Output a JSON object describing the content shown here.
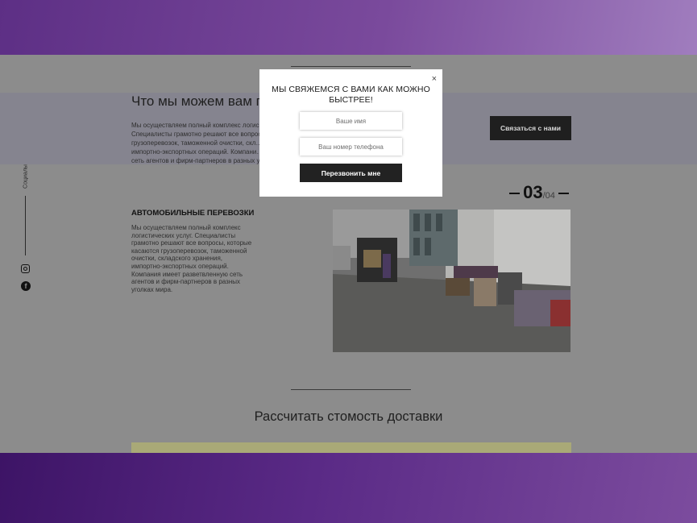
{
  "services": {
    "title": "Что мы можем вам п",
    "text": "Мы осуществляем полный комплекс логис… Специалисты грамотно решают все вопросы грузоперевозок, таможенной очистки, скл… импортно-экспортных операций. Компани… сеть агентов и фирм-партнеров в разных у…",
    "contact_button": "Связаться с нами"
  },
  "sidebar": {
    "label": "Социалы",
    "icons": [
      "instagram-icon",
      "facebook-icon"
    ]
  },
  "slider": {
    "current": "03",
    "total": "/04",
    "title": "АВТОМОБИЛЬНЫЕ ПЕРЕВОЗКИ",
    "text": "Мы осуществляем полный комплекс логистических услуг. Специалисты грамотно решают все вопросы, которые касаются грузоперевозок, таможенной очистки, складского хранения, импортно-экспортных операций. Компания имеет разветвленную сеть агентов и фирм-партнеров в разных уголках мира."
  },
  "calculator": {
    "title": "Рассчитать стомость доставки"
  },
  "modal": {
    "title": "МЫ СВЯЖЕМСЯ С ВАМИ КАК МОЖНО БЫСТРЕЕ!",
    "close": "×",
    "name_placeholder": "Ваше имя",
    "phone_placeholder": "Ваш номер телефона",
    "submit": "Перезвонить мне"
  },
  "colors": {
    "top_band": "#7a4a9c",
    "bottom_band": "#4e2178",
    "overlay": "#8c8c8c",
    "button_dark": "#1f1f1f"
  }
}
